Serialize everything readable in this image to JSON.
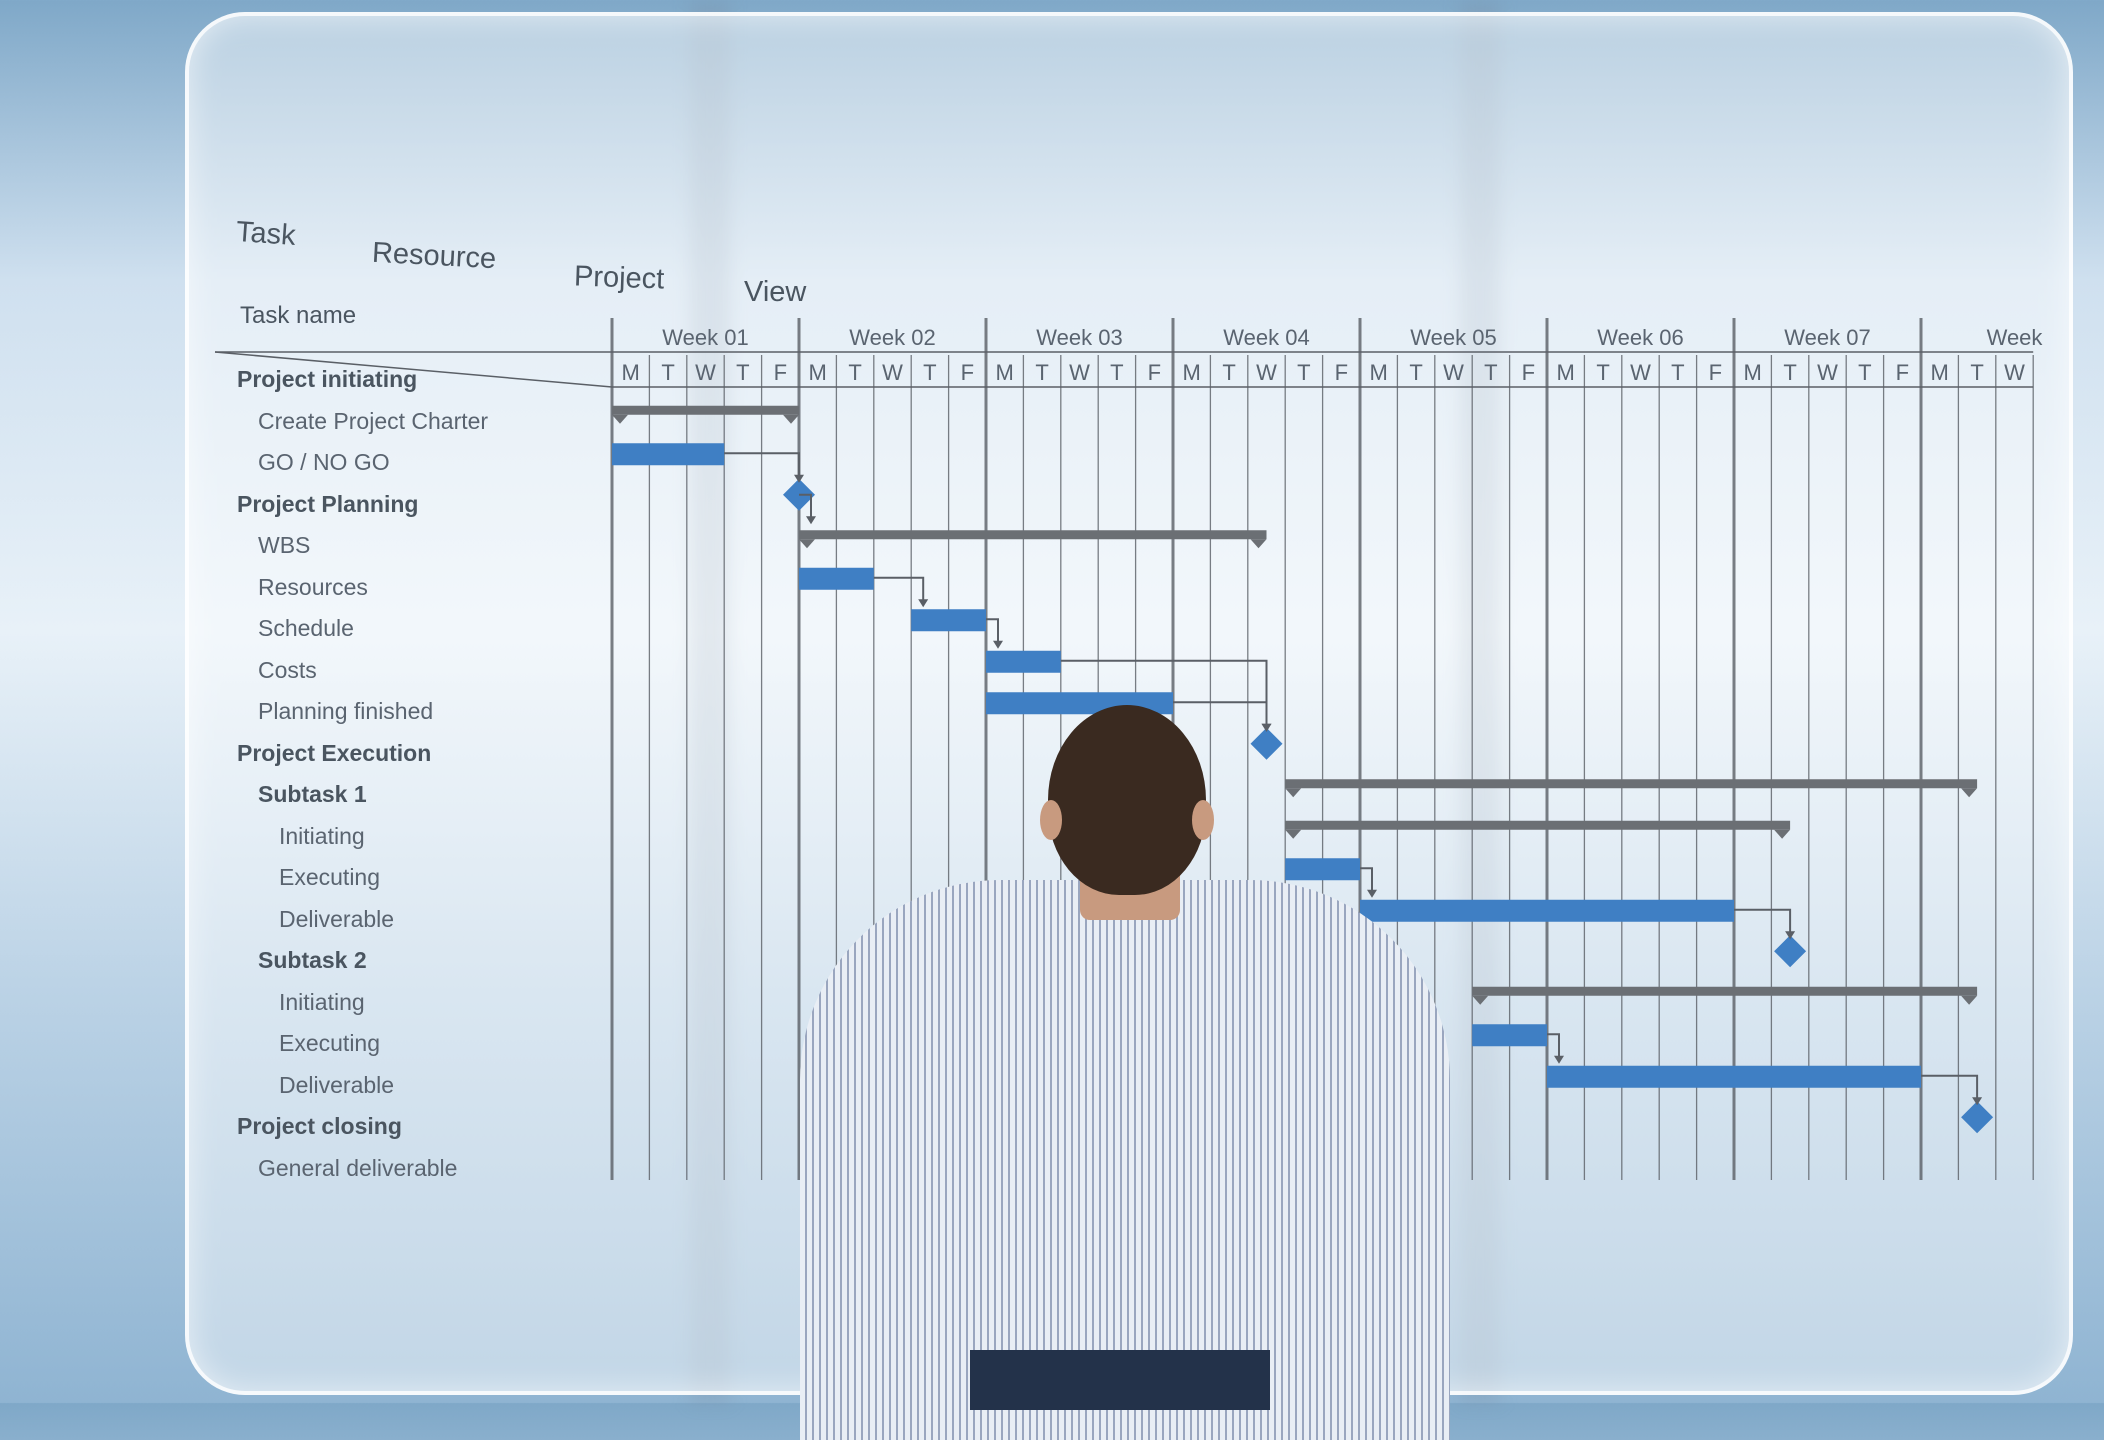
{
  "menu": {
    "items": [
      "Task",
      "Resource",
      "Project",
      "View"
    ]
  },
  "task_name_header": "Task name",
  "colors": {
    "task_bar": "#3f7fc4",
    "summary_bar": "#6b6f74",
    "milestone": "#3f7fc4",
    "grid": "#5a5f66"
  },
  "chart_data": {
    "type": "gantt",
    "weeks": [
      "Week 01",
      "Week 02",
      "Week 03",
      "Week 04",
      "Week 05",
      "Week 06",
      "Week 07",
      "Week"
    ],
    "day_labels": [
      "M",
      "T",
      "W",
      "T",
      "F"
    ],
    "visible_days": 38,
    "tasks": [
      {
        "name": "Project initiating",
        "level": 0,
        "type": "summary",
        "start": 0,
        "end": 5
      },
      {
        "name": "Create Project Charter",
        "level": 1,
        "type": "task",
        "start": 0,
        "end": 3
      },
      {
        "name": "GO / NO GO",
        "level": 1,
        "type": "milestone",
        "start": 4.5,
        "end": 4.5
      },
      {
        "name": "Project Planning",
        "level": 0,
        "type": "summary",
        "start": 5,
        "end": 17.5
      },
      {
        "name": "WBS",
        "level": 1,
        "type": "task",
        "start": 5,
        "end": 7
      },
      {
        "name": "Resources",
        "level": 1,
        "type": "task",
        "start": 8,
        "end": 10
      },
      {
        "name": "Schedule",
        "level": 1,
        "type": "task",
        "start": 10,
        "end": 12
      },
      {
        "name": "Costs",
        "level": 1,
        "type": "task",
        "start": 10,
        "end": 15
      },
      {
        "name": "Planning finished",
        "level": 1,
        "type": "milestone",
        "start": 17,
        "end": 17
      },
      {
        "name": "Project Execution",
        "level": 0,
        "type": "summary",
        "start": 18,
        "end": 36.5
      },
      {
        "name": "Subtask 1",
        "level": 1,
        "bold": true,
        "type": "summary",
        "start": 18,
        "end": 31.5
      },
      {
        "name": "Initiating",
        "level": 2,
        "type": "task",
        "start": 18,
        "end": 20
      },
      {
        "name": "Executing",
        "level": 2,
        "type": "task",
        "start": 20,
        "end": 30
      },
      {
        "name": "Deliverable",
        "level": 2,
        "type": "milestone",
        "start": 31,
        "end": 31
      },
      {
        "name": "Subtask 2",
        "level": 1,
        "bold": true,
        "type": "summary",
        "start": 23,
        "end": 36.5
      },
      {
        "name": "Initiating",
        "level": 2,
        "type": "task",
        "start": 23,
        "end": 25
      },
      {
        "name": "Executing",
        "level": 2,
        "type": "task",
        "start": 25,
        "end": 35
      },
      {
        "name": "Deliverable",
        "level": 2,
        "type": "milestone",
        "start": 36,
        "end": 36
      },
      {
        "name": "Project closing",
        "level": 0,
        "type": "none"
      },
      {
        "name": "General deliverable",
        "level": 1,
        "type": "none"
      }
    ],
    "dependencies": [
      [
        1,
        2
      ],
      [
        2,
        3
      ],
      [
        4,
        5
      ],
      [
        5,
        6
      ],
      [
        6,
        8
      ],
      [
        7,
        8
      ],
      [
        11,
        12
      ],
      [
        12,
        13
      ],
      [
        15,
        16
      ],
      [
        16,
        17
      ]
    ]
  }
}
